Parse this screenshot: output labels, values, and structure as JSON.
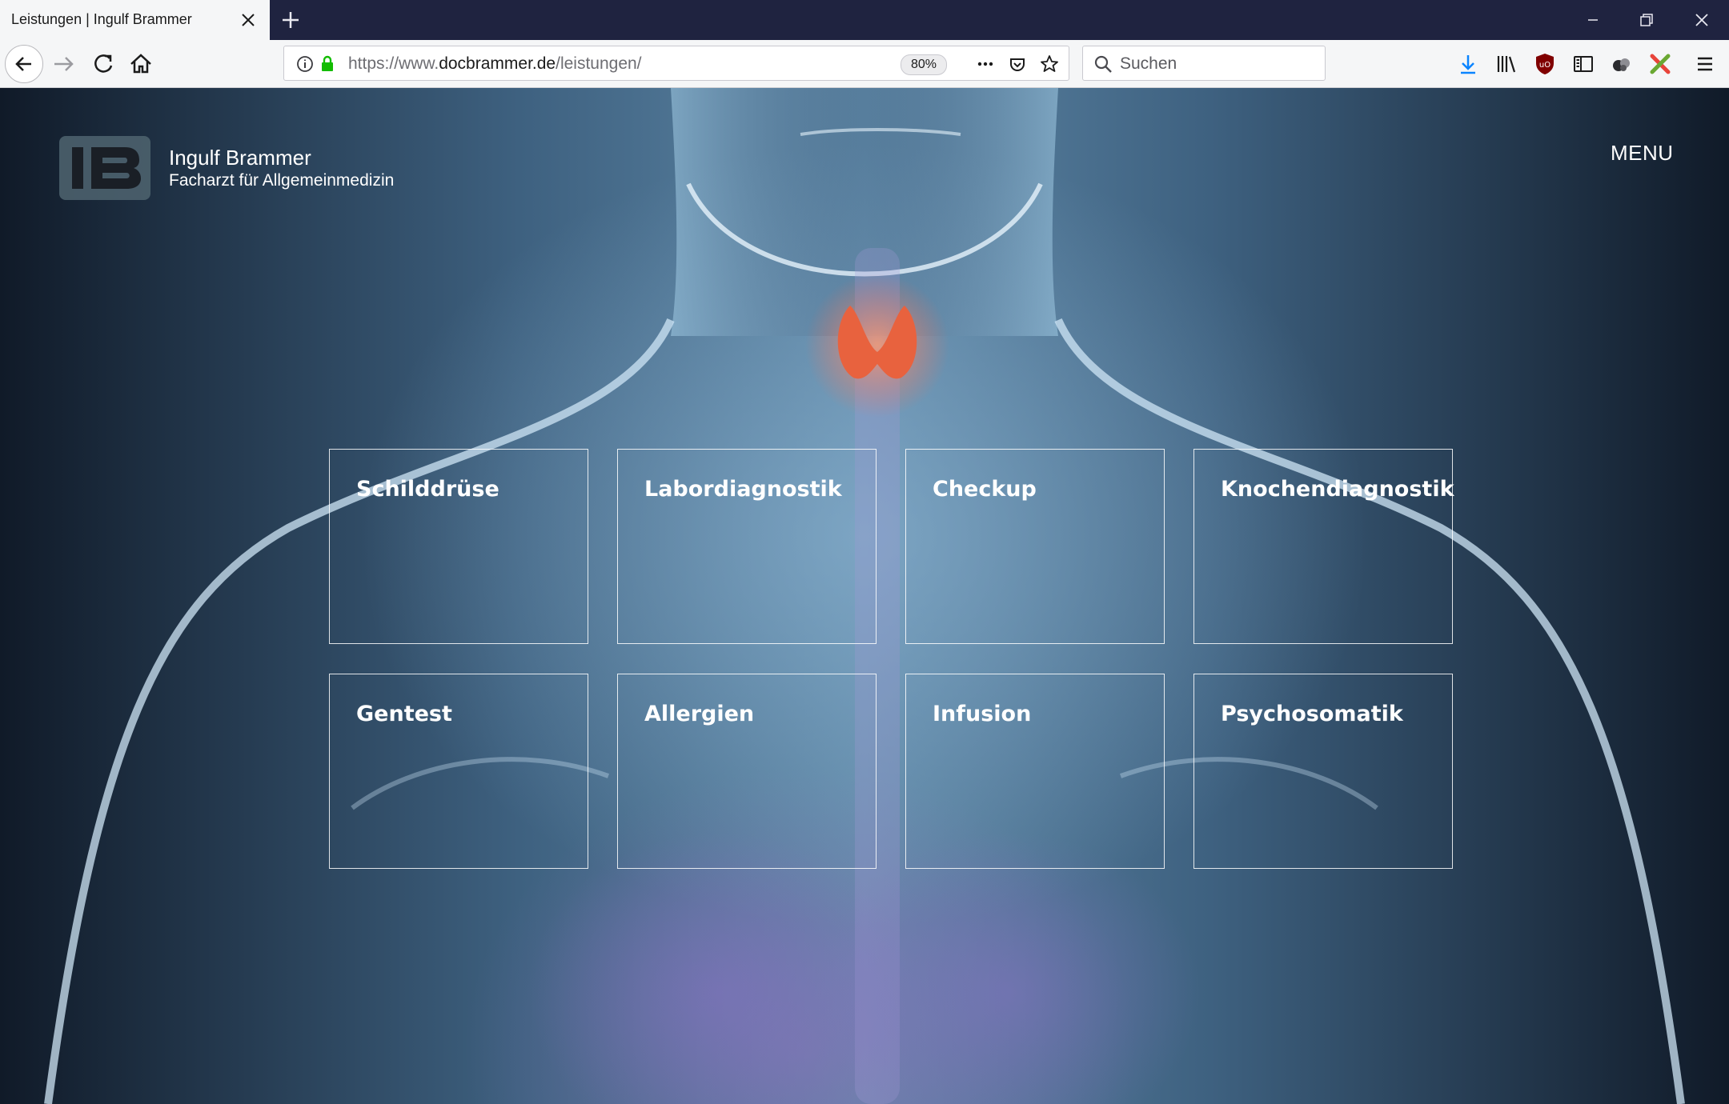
{
  "browser": {
    "tab": {
      "title": "Leistungen | Ingulf Brammer"
    },
    "url": {
      "prefix": "https://www.",
      "domain": "docbrammer.de",
      "path": "/leistungen/"
    },
    "zoom": "80%",
    "search": {
      "placeholder": "Suchen"
    }
  },
  "site": {
    "brand": {
      "name": "Ingulf Brammer",
      "subtitle": "Facharzt für Allgemeinmedizin"
    },
    "menu_label": "MENU",
    "services": [
      {
        "label": "Schilddrüse"
      },
      {
        "label": "Labordiagnostik"
      },
      {
        "label": "Checkup"
      },
      {
        "label": "Knochendiagnostik"
      },
      {
        "label": "Gentest"
      },
      {
        "label": "Allergien"
      },
      {
        "label": "Infusion"
      },
      {
        "label": "Psychosomatik"
      }
    ]
  },
  "colors": {
    "chrome_dark": "#1f2340",
    "accent_green": "#12bc00",
    "download_blue": "#0a84ff"
  }
}
